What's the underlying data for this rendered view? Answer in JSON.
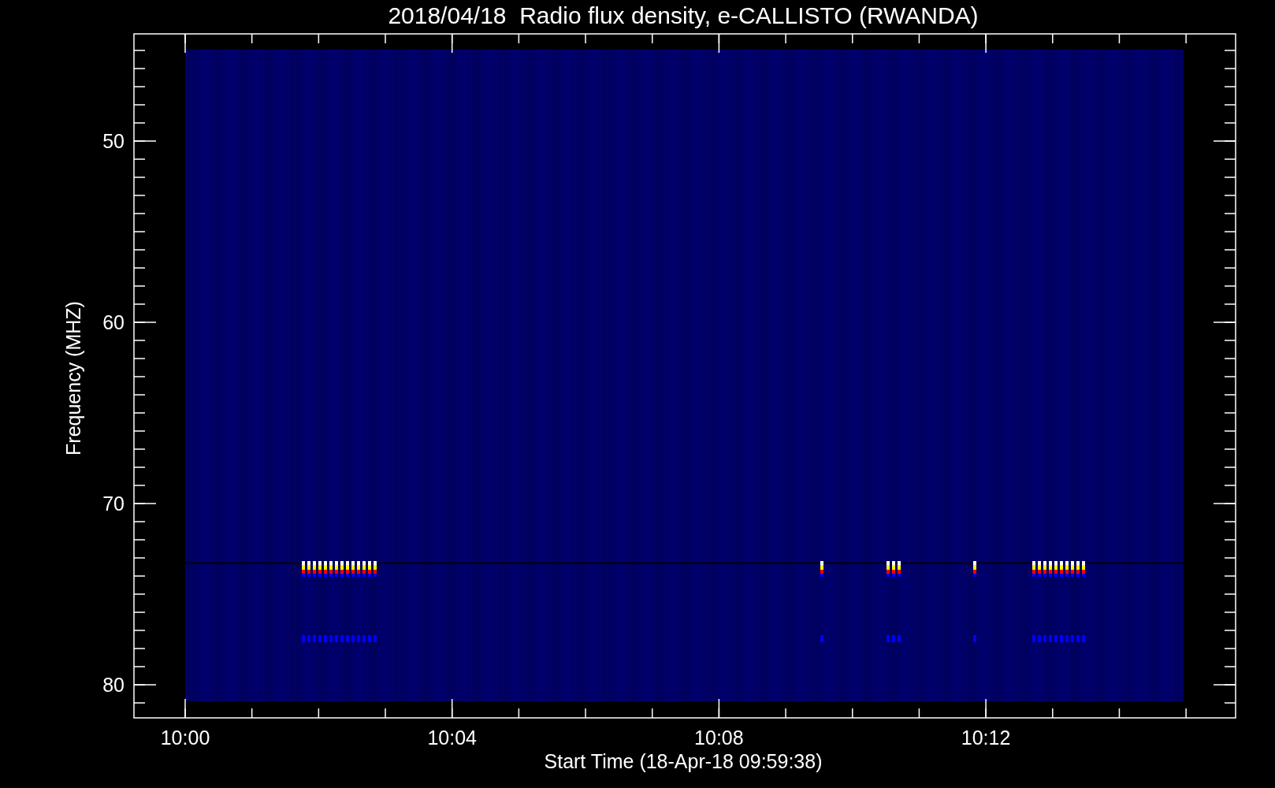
{
  "title": "2018/04/18  Radio flux density, e-CALLISTO (RWANDA)",
  "y_axis": {
    "label": "Frequency (MHZ)",
    "tick_labels": [
      "50",
      "60",
      "70",
      "80"
    ]
  },
  "x_axis": {
    "label": "Start Time (18-Apr-18 09:59:38)",
    "tick_labels": [
      "10:00",
      "10:04",
      "10:08",
      "10:12"
    ]
  }
}
